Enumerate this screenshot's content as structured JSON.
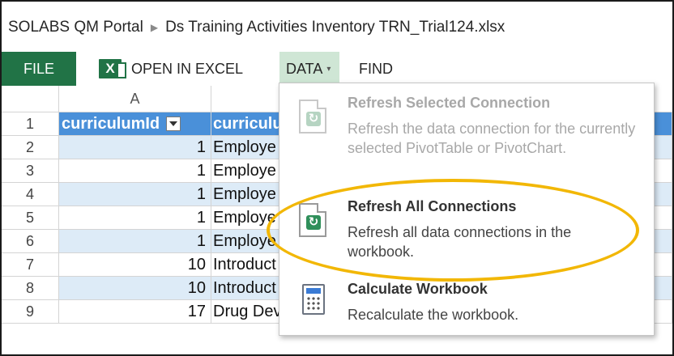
{
  "breadcrumb": {
    "portal": "SOLABS QM Portal",
    "separator": "▶",
    "file": "Ds Training Activities Inventory TRN_Trial124.xlsx"
  },
  "ribbon": {
    "file_tab": "FILE",
    "open_in_excel": "OPEN IN EXCEL",
    "excel_icon_letter": "X",
    "data_tab": "DATA",
    "data_caret": "▾",
    "find_tab": "FIND"
  },
  "sheet": {
    "column_headers": [
      "A"
    ],
    "header_row": {
      "row": "1",
      "a": "curriculumId",
      "b": "curriculu"
    },
    "rows": [
      {
        "row": "2",
        "a": "1",
        "b": "Employe"
      },
      {
        "row": "3",
        "a": "1",
        "b": "Employe"
      },
      {
        "row": "4",
        "a": "1",
        "b": "Employe"
      },
      {
        "row": "5",
        "a": "1",
        "b": "Employe"
      },
      {
        "row": "6",
        "a": "1",
        "b": "Employe"
      },
      {
        "row": "7",
        "a": "10",
        "b": "Introduct"
      },
      {
        "row": "8",
        "a": "10",
        "b": "Introduct"
      },
      {
        "row": "9",
        "a": "17",
        "b": "Drug Development"
      }
    ]
  },
  "data_menu": {
    "items": [
      {
        "title": "Refresh Selected Connection",
        "description": "Refresh the data connection for the currently selected PivotTable or PivotChart.",
        "icon": "refresh-connection-icon",
        "enabled": false
      },
      {
        "title": "Refresh All Connections",
        "description": "Refresh all data connections in the workbook.",
        "icon": "refresh-all-icon",
        "enabled": true
      },
      {
        "title": "Calculate Workbook",
        "description": "Recalculate the workbook.",
        "icon": "calculator-icon",
        "enabled": true
      }
    ],
    "refresh_glyph": "↻"
  },
  "colors": {
    "excel_green": "#217346",
    "data_tab_bg": "#cfe6d5",
    "header_blue": "#4a90d9",
    "band_blue": "#ddebf7",
    "highlight": "#f2b705"
  }
}
